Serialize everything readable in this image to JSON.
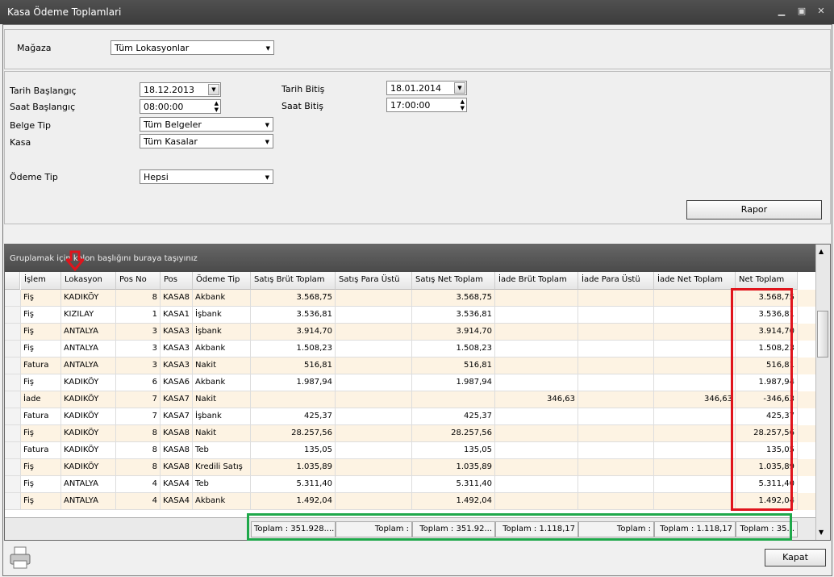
{
  "window": {
    "title": "Kasa Ödeme Toplamlari"
  },
  "store": {
    "label": "Mağaza",
    "value": "Tüm Lokasyonlar"
  },
  "filters": {
    "date_start_label": "Tarih Başlangıç",
    "date_start": "18.12.2013",
    "time_start_label": "Saat Başlangıç",
    "time_start": "08:00:00",
    "date_end_label": "Tarih Bitiş",
    "date_end": "18.01.2014",
    "time_end_label": "Saat Bitiş",
    "time_end": "17:00:00",
    "doc_type_label": "Belge Tip",
    "doc_type": "Tüm Belgeler",
    "register_label": "Kasa",
    "register": "Tüm Kasalar",
    "payment_type_label": "Ödeme Tip",
    "payment_type": "Hepsi"
  },
  "report_button": "Rapor",
  "grid": {
    "group_hint": "Gruplamak için kolon başlığını buraya taşıyınız",
    "columns": [
      "İşlem",
      "Lokasyon",
      "Pos No",
      "Pos",
      "Ödeme Tip",
      "Satış Brüt Toplam",
      "Satış Para Üstü",
      "Satış Net Toplam",
      "İade Brüt Toplam",
      "İade Para Üstü",
      "İade Net Toplam",
      "Net Toplam"
    ],
    "rows": [
      [
        "Fiş",
        "KADIKÖY",
        "8",
        "KASA8",
        "Akbank",
        "3.568,75",
        "",
        "3.568,75",
        "",
        "",
        "",
        "3.568,75"
      ],
      [
        "Fiş",
        "KIZILAY",
        "1",
        "KASA1",
        "İşbank",
        "3.536,81",
        "",
        "3.536,81",
        "",
        "",
        "",
        "3.536,81"
      ],
      [
        "Fiş",
        "ANTALYA",
        "3",
        "KASA3",
        "İşbank",
        "3.914,70",
        "",
        "3.914,70",
        "",
        "",
        "",
        "3.914,70"
      ],
      [
        "Fiş",
        "ANTALYA",
        "3",
        "KASA3",
        "Akbank",
        "1.508,23",
        "",
        "1.508,23",
        "",
        "",
        "",
        "1.508,23"
      ],
      [
        "Fatura",
        "ANTALYA",
        "3",
        "KASA3",
        "Nakit",
        "516,81",
        "",
        "516,81",
        "",
        "",
        "",
        "516,81"
      ],
      [
        "Fiş",
        "KADIKÖY",
        "6",
        "KASA6",
        "Akbank",
        "1.987,94",
        "",
        "1.987,94",
        "",
        "",
        "",
        "1.987,94"
      ],
      [
        "İade",
        "KADIKÖY",
        "7",
        "KASA7",
        "Nakit",
        "",
        "",
        "",
        "346,63",
        "",
        "346,63",
        "-346,63"
      ],
      [
        "Fatura",
        "KADIKÖY",
        "7",
        "KASA7",
        "İşbank",
        "425,37",
        "",
        "425,37",
        "",
        "",
        "",
        "425,37"
      ],
      [
        "Fiş",
        "KADIKÖY",
        "8",
        "KASA8",
        "Nakit",
        "28.257,56",
        "",
        "28.257,56",
        "",
        "",
        "",
        "28.257,56"
      ],
      [
        "Fatura",
        "KADIKÖY",
        "8",
        "KASA8",
        "Teb",
        "135,05",
        "",
        "135,05",
        "",
        "",
        "",
        "135,05"
      ],
      [
        "Fiş",
        "KADIKÖY",
        "8",
        "KASA8",
        "Kredili Satış",
        "1.035,89",
        "",
        "1.035,89",
        "",
        "",
        "",
        "1.035,89"
      ],
      [
        "Fiş",
        "ANTALYA",
        "4",
        "KASA4",
        "Teb",
        "5.311,40",
        "",
        "5.311,40",
        "",
        "",
        "",
        "5.311,40"
      ],
      [
        "Fiş",
        "ANTALYA",
        "4",
        "KASA4",
        "Akbank",
        "1.492,04",
        "",
        "1.492,04",
        "",
        "",
        "",
        "1.492,04"
      ]
    ],
    "totals": [
      "Toplam : 351.928....",
      "Toplam :",
      "Toplam : 351.92...",
      "Toplam : 1.118,17",
      "Toplam :",
      "Toplam : 1.118,17",
      "Toplam : 35..."
    ]
  },
  "close_button": "Kapat",
  "colors": {
    "row_alt": "#fdf3e3",
    "highlight_red": "#e0141c",
    "highlight_green": "#1ea84a"
  }
}
